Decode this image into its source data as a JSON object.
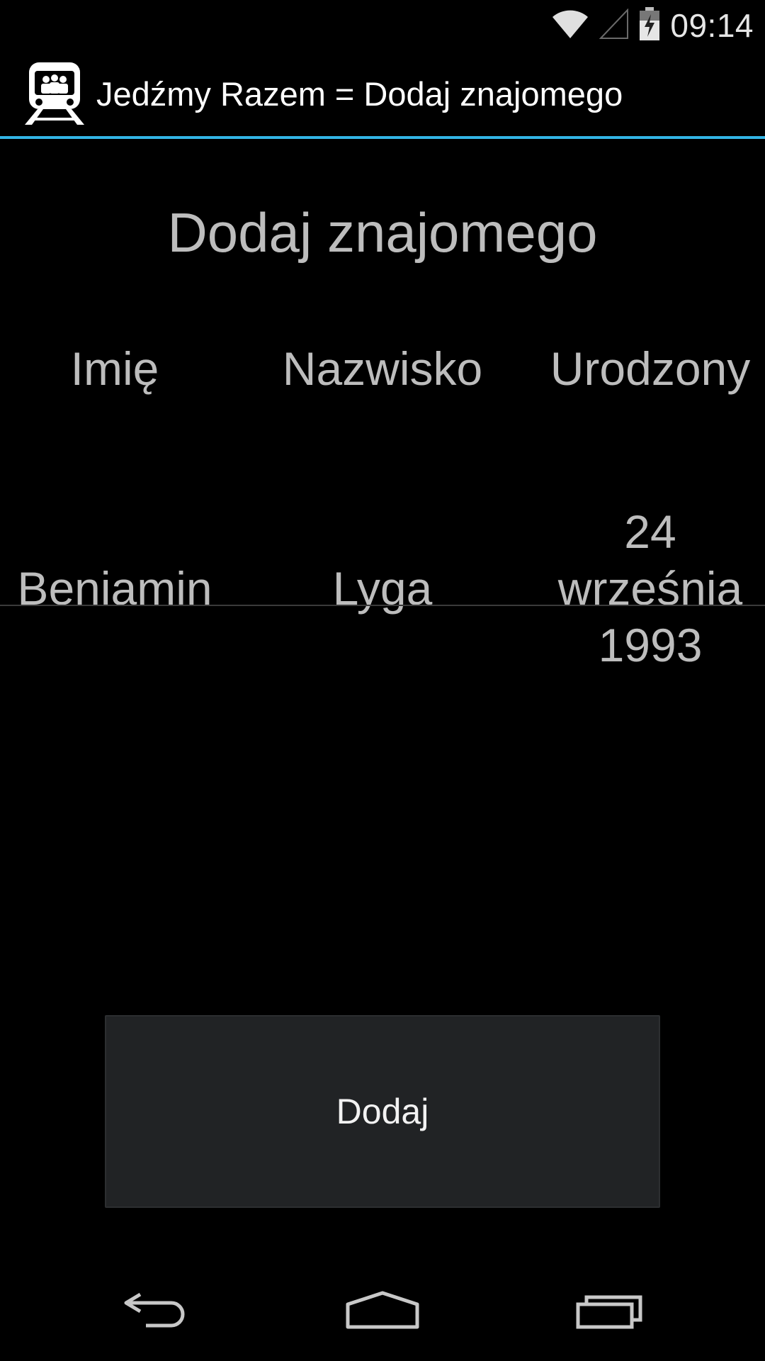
{
  "status_bar": {
    "time": "09:14",
    "icons": [
      "wifi-icon",
      "cell-signal-icon",
      "battery-charging-icon"
    ]
  },
  "action_bar": {
    "title": "Jedźmy Razem = Dodaj znajomego",
    "icon": "train-icon",
    "accent_color": "#33b5e5"
  },
  "main": {
    "heading": "Dodaj znajomego",
    "table": {
      "columns": [
        "Imię",
        "Nazwisko",
        "Urodzony"
      ],
      "rows": [
        {
          "first_name": "Beniamin",
          "last_name": "Lyga",
          "birth_line1": "24",
          "birth_line2": "września",
          "birth_line3": "1993"
        }
      ]
    },
    "add_button_label": "Dodaj"
  },
  "nav_bar": {
    "buttons": [
      "back-icon",
      "home-icon",
      "recents-icon"
    ]
  }
}
